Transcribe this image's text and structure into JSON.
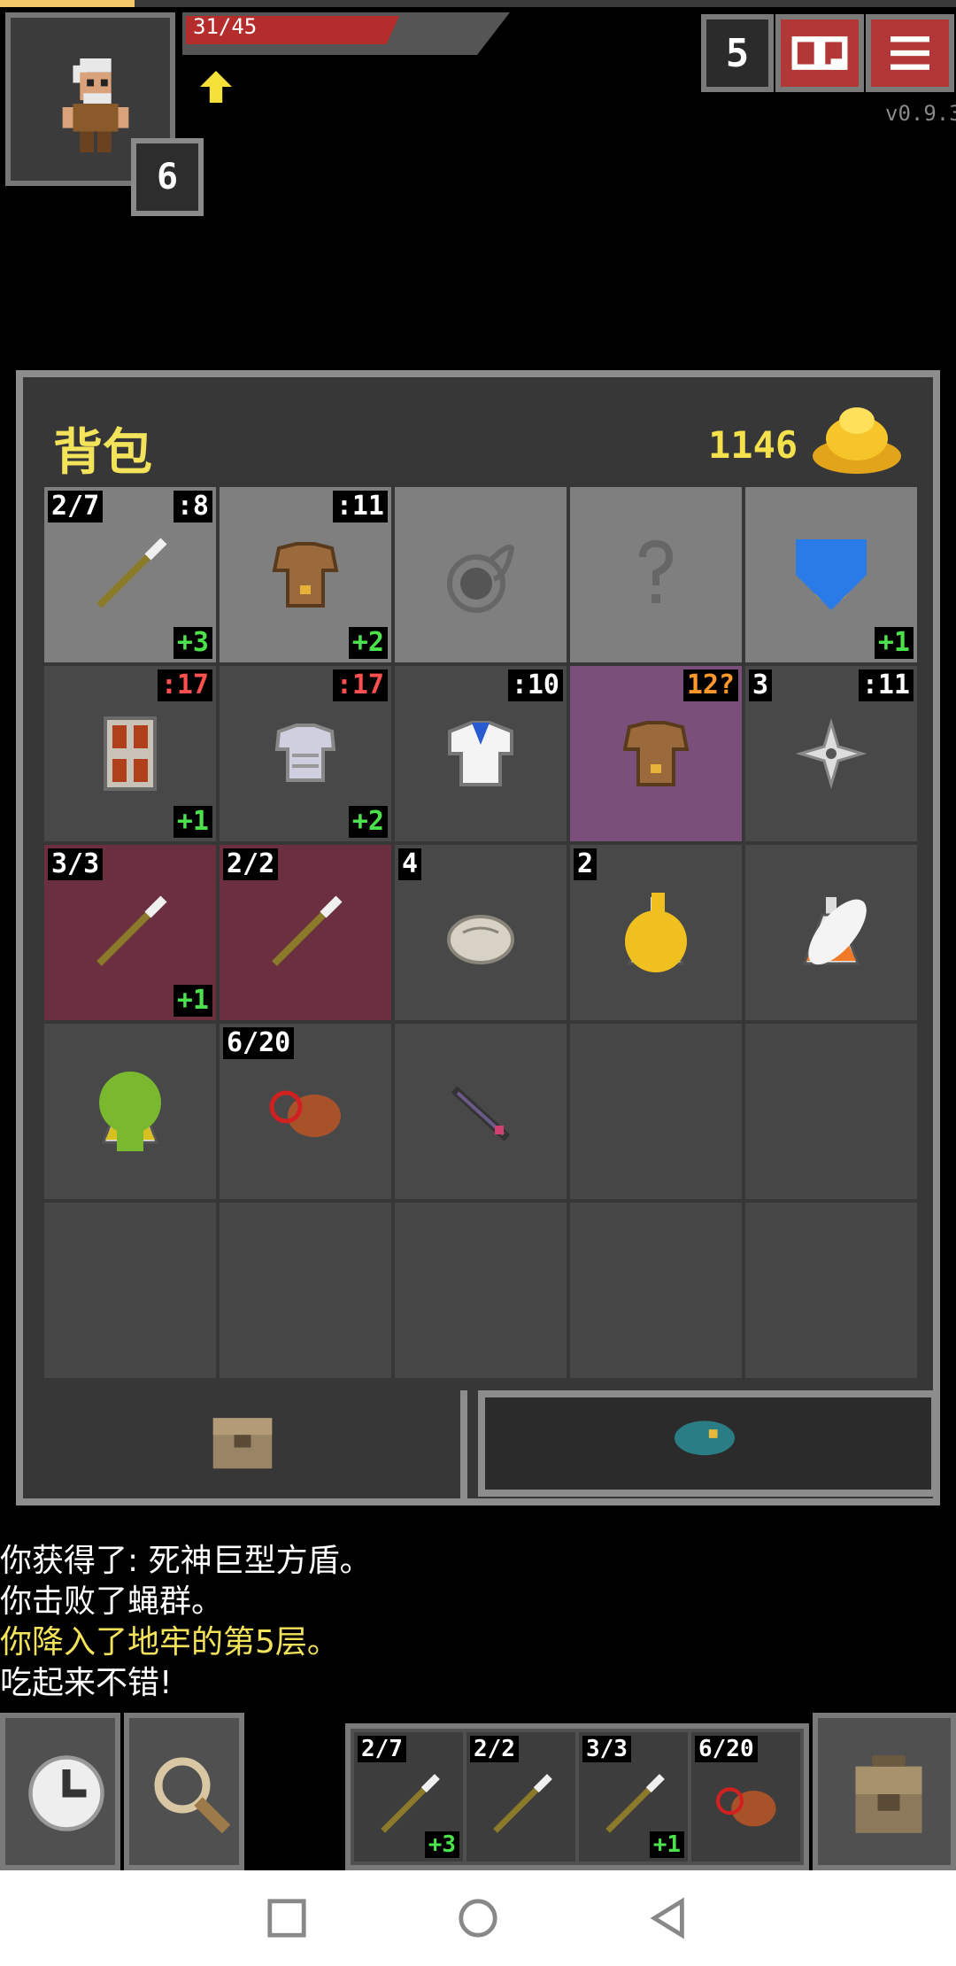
{
  "hud": {
    "hp_text": "31/45",
    "hp_fraction": 0.69,
    "level": "6",
    "depth": "5",
    "version": "v0.9.3",
    "colors": {
      "hp": "#b42c2c",
      "buttons": "#b23838",
      "gold": "#f5e14c"
    }
  },
  "bag": {
    "title": "背包",
    "gold": "1146",
    "slots": [
      {
        "tl": "2/7",
        "tr": ":8",
        "br": "+3",
        "icon": "wand-icon",
        "state": "equipped"
      },
      {
        "tr": ":11",
        "br": "+2",
        "icon": "leather-armor-icon",
        "state": "equipped"
      },
      {
        "icon": "empty-artifact-slot-icon",
        "state": "equipped"
      },
      {
        "icon": "empty-misc-slot-icon",
        "state": "equipped"
      },
      {
        "br": "+1",
        "icon": "ring-icon",
        "state": "equipped",
        "badge": "shield-badge-icon"
      },
      {
        "tr": ":17",
        "tr_color": "red",
        "br": "+1",
        "icon": "tower-shield-icon",
        "state": "normal"
      },
      {
        "tr": ":17",
        "tr_color": "red",
        "br": "+2",
        "icon": "plate-armor-icon",
        "state": "normal"
      },
      {
        "tr": ":10",
        "icon": "robe-icon",
        "state": "normal"
      },
      {
        "tr": "12?",
        "tr_color": "orange",
        "icon": "leather-armor-icon",
        "state": "unknown"
      },
      {
        "tl": "3",
        "tr": ":11",
        "icon": "shuriken-icon",
        "state": "normal"
      },
      {
        "tl": "3/3",
        "br": "+1",
        "icon": "wand-icon",
        "state": "cursed"
      },
      {
        "tl": "2/2",
        "icon": "wand-icon",
        "state": "cursed"
      },
      {
        "tl": "4",
        "icon": "ration-icon",
        "state": "normal"
      },
      {
        "tl": "2",
        "icon": "potion-dark-icon",
        "state": "normal",
        "badge": "flame-badge-icon"
      },
      {
        "icon": "potion-orange-icon",
        "state": "normal",
        "badge": "feather-badge-icon"
      },
      {
        "icon": "potion-yellow-icon",
        "state": "normal",
        "badge": "skull-badge-icon"
      },
      {
        "tl": "6/20",
        "icon": "meat-icon",
        "state": "normal"
      },
      {
        "icon": "dart-icon",
        "state": "normal"
      },
      {
        "icon": "",
        "state": "empty"
      },
      {
        "icon": "",
        "state": "empty"
      },
      {
        "icon": "",
        "state": "empty"
      },
      {
        "icon": "",
        "state": "empty"
      },
      {
        "icon": "",
        "state": "empty"
      },
      {
        "icon": "",
        "state": "empty"
      },
      {
        "icon": "",
        "state": "empty"
      }
    ]
  },
  "log": {
    "line1": "你获得了: 死神巨型方盾。",
    "line2": "你击败了蝇群。",
    "line3": "你降入了地牢的第5层。",
    "line4": "吃起来不错!"
  },
  "quickslots": [
    {
      "tl": "2/7",
      "br": "+3",
      "icon": "wand-icon"
    },
    {
      "tl": "2/2",
      "icon": "wand-icon"
    },
    {
      "tl": "3/3",
      "br": "+1",
      "icon": "wand-icon"
    },
    {
      "tl": "6/20",
      "icon": "meat-icon"
    }
  ]
}
